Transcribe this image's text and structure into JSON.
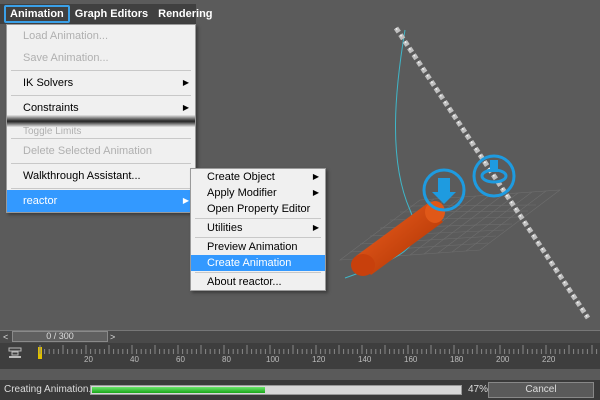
{
  "menubar": {
    "items": [
      {
        "label": "Animation"
      },
      {
        "label": "Graph Editors"
      },
      {
        "label": "Rendering"
      }
    ]
  },
  "animation_menu": {
    "load_animation": "Load Animation...",
    "save_animation": "Save Animation...",
    "ik_solvers": "IK Solvers",
    "constraints": "Constraints",
    "toggle_limits": "Toggle Limits",
    "delete_selected_animation": "Delete Selected Animation",
    "walkthrough_assistant": "Walkthrough Assistant...",
    "reactor": "reactor"
  },
  "reactor_menu": {
    "create_object": "Create Object",
    "apply_modifier": "Apply Modifier",
    "open_property_editor": "Open Property Editor",
    "utilities": "Utilities",
    "preview_animation": "Preview Animation",
    "create_animation": "Create Animation",
    "about_reactor": "About reactor..."
  },
  "timeslider": {
    "frame_display": "0 / 300",
    "prev": "<",
    "next": ">"
  },
  "trackbar": {
    "ticks": [
      "20",
      "40",
      "60",
      "80",
      "100",
      "120",
      "140",
      "160",
      "180",
      "200",
      "220"
    ]
  },
  "status": {
    "text": "Creating Animation...",
    "progress_percent": 47,
    "progress_label": "47%",
    "cancel_label": "Cancel"
  },
  "colors": {
    "accent": "#3399ff",
    "cylinder": "#d84a10",
    "gizmo": "#1e9be0",
    "progress": "#22b022"
  }
}
